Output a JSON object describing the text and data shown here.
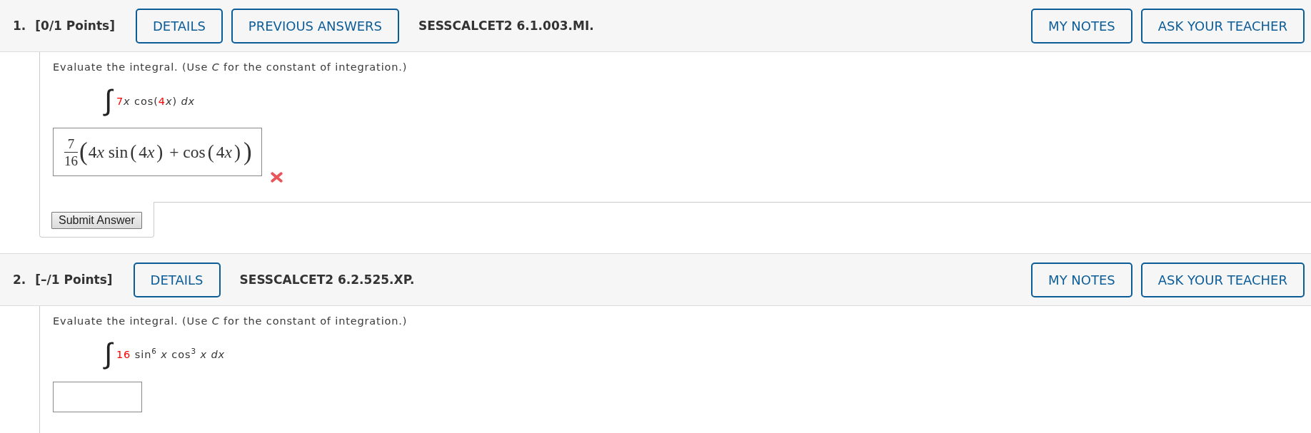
{
  "questions": [
    {
      "number": "1.",
      "points": "[0/1 Points]",
      "details_button": "DETAILS",
      "previous_answers_button": "PREVIOUS ANSWERS",
      "code": "SESSCALCET2 6.1.003.MI.",
      "my_notes_button": "MY NOTES",
      "ask_teacher_button": "ASK YOUR TEACHER",
      "prompt": "Evaluate the integral. (Use *C* for the constant of integration.)",
      "integral": {
        "sign": "∫",
        "integrand": [
          {
            "kind": "param",
            "text": "7"
          },
          {
            "kind": "var",
            "text": "x"
          },
          {
            "kind": "text",
            "text": " cos("
          },
          {
            "kind": "param",
            "text": "4"
          },
          {
            "kind": "var",
            "text": "x"
          },
          {
            "kind": "text",
            "text": ") "
          },
          {
            "kind": "var",
            "text": "dx"
          }
        ]
      },
      "answer": {
        "numerator": "7",
        "denominator": "16",
        "terms": [
          {
            "kind": "big-paren",
            "text": "("
          },
          {
            "kind": "text",
            "text": "4"
          },
          {
            "kind": "var",
            "text": "x"
          },
          {
            "kind": "text",
            "text": " sin"
          },
          {
            "kind": "paren",
            "text": "("
          },
          {
            "kind": "text",
            "text": "4"
          },
          {
            "kind": "var",
            "text": "x"
          },
          {
            "kind": "paren",
            "text": ")"
          },
          {
            "kind": "text",
            "text": " + cos"
          },
          {
            "kind": "paren",
            "text": "("
          },
          {
            "kind": "text",
            "text": "4"
          },
          {
            "kind": "var",
            "text": "x"
          },
          {
            "kind": "paren",
            "text": ")"
          },
          {
            "kind": "big-paren",
            "text": ")"
          }
        ]
      },
      "correct": false,
      "submit_button": "Submit Answer"
    },
    {
      "number": "2.",
      "points": "[–/1 Points]",
      "details_button": "DETAILS",
      "code": "SESSCALCET2 6.2.525.XP.",
      "my_notes_button": "MY NOTES",
      "ask_teacher_button": "ASK YOUR TEACHER",
      "prompt": "Evaluate the integral. (Use *C* for the constant of integration.)",
      "integral": {
        "sign": "∫",
        "integrand": [
          {
            "kind": "param",
            "text": "16"
          },
          {
            "kind": "text",
            "text": " sin"
          },
          {
            "kind": "sup",
            "text": "6"
          },
          {
            "kind": "var",
            "text": " x"
          },
          {
            "kind": "text",
            "text": " cos"
          },
          {
            "kind": "sup",
            "text": "3"
          },
          {
            "kind": "var",
            "text": " x dx"
          }
        ]
      }
    }
  ]
}
